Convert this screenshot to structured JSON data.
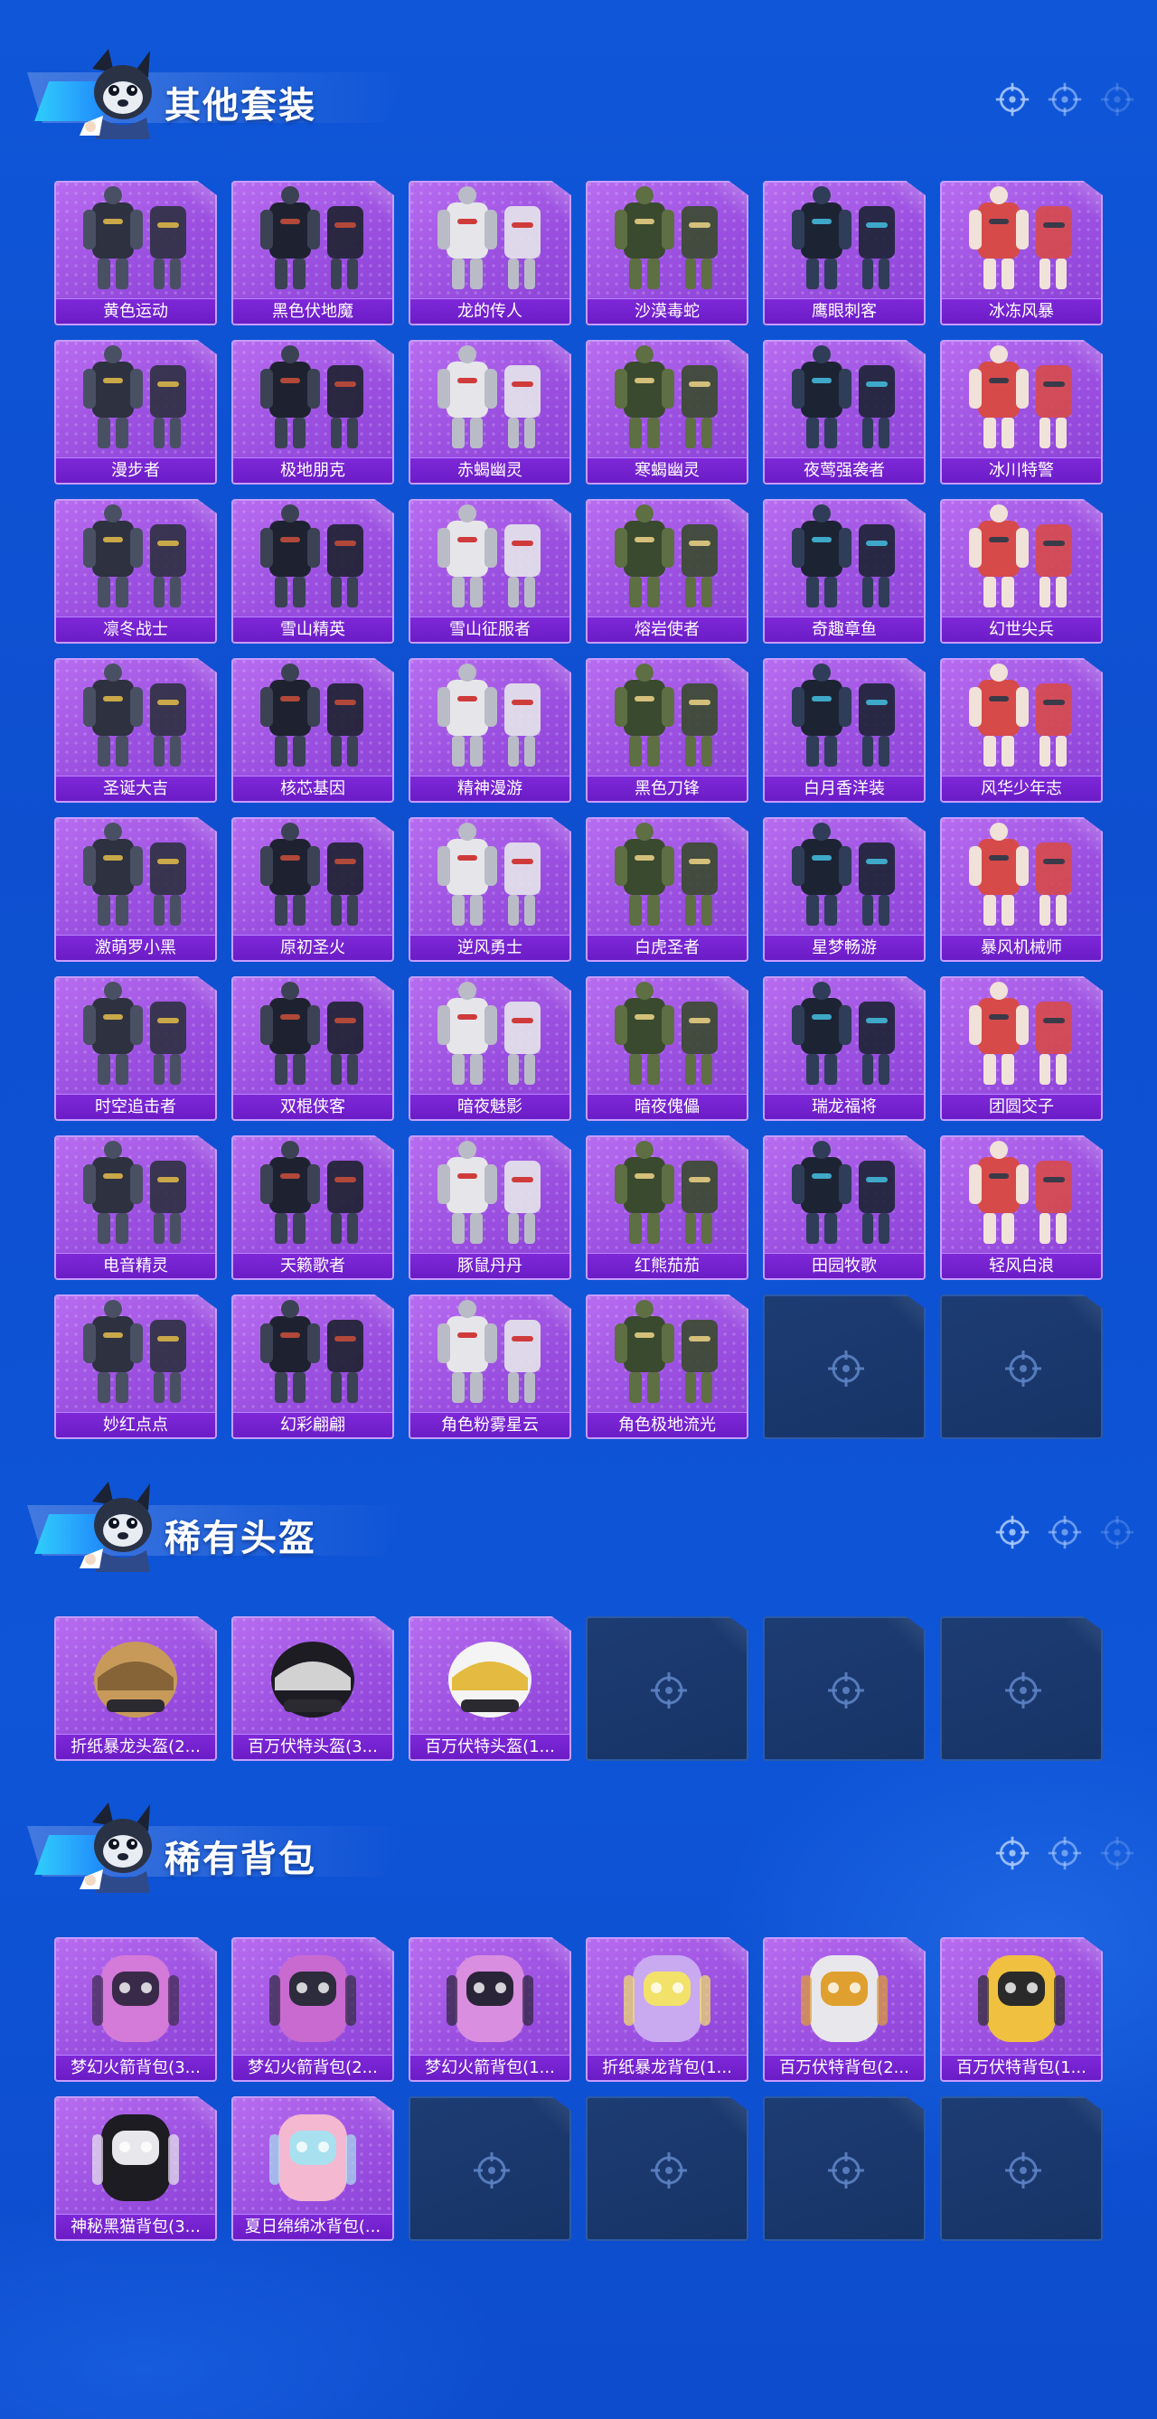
{
  "sections": [
    {
      "title": "其他套装",
      "items": [
        "黄色运动",
        "黑色伏地魔",
        "龙的传人",
        "沙漠毒蛇",
        "鹰眼刺客",
        "冰冻风暴",
        "漫步者",
        "极地朋克",
        "赤蝎幽灵",
        "寒蝎幽灵",
        "夜莺强袭者",
        "冰川特警",
        "凛冬战士",
        "雪山精英",
        "雪山征服者",
        "熔岩使者",
        "奇趣章鱼",
        "幻世尖兵",
        "圣诞大吉",
        "核芯基因",
        "精神漫游",
        "黑色刀锋",
        "白月香洋装",
        "风华少年志",
        "激萌罗小黑",
        "原初圣火",
        "逆风勇士",
        "白虎圣者",
        "星梦畅游",
        "暴风机械师",
        "时空追击者",
        "双棍侠客",
        "暗夜魅影",
        "暗夜傀儡",
        "瑞龙福将",
        "团圆交子",
        "电音精灵",
        "天籁歌者",
        "豚鼠丹丹",
        "红熊茄茄",
        "田园牧歌",
        "轻风白浪",
        "妙红点点",
        "幻彩翩翩",
        "角色粉雾星云",
        "角色极地流光"
      ],
      "empty_slots": 2
    },
    {
      "title": "稀有头盔",
      "items": [
        "折纸暴龙头盔(2...",
        "百万伏特头盔(3...",
        "百万伏特头盔(1..."
      ],
      "empty_slots": 3
    },
    {
      "title": "稀有背包",
      "items": [
        "梦幻火箭背包(3...",
        "梦幻火箭背包(2...",
        "梦幻火箭背包(1...",
        "折纸暴龙背包(1...",
        "百万伏特背包(2...",
        "百万伏特背包(1...",
        "神秘黑猫背包(3...",
        "夏日绵绵冰背包(..."
      ],
      "empty_slots": 4
    }
  ],
  "colors": {
    "background": "#0f56d8",
    "card_purple": "#9a4fe0",
    "card_label": "#6b1cc6",
    "empty_slot": "#1d3c73"
  },
  "icons": {
    "header_mascot": "mascot-icon",
    "header_deco": "crosshair-icon",
    "empty_slot": "crosshair-icon"
  }
}
